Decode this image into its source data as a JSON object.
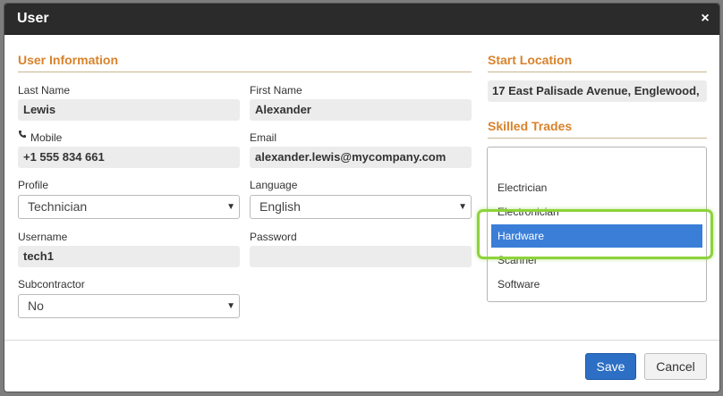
{
  "dialog": {
    "title": "User",
    "close_label": "×"
  },
  "user_info": {
    "section_title": "User Information",
    "last_name": {
      "label": "Last Name",
      "value": "Lewis"
    },
    "first_name": {
      "label": "First Name",
      "value": "Alexander"
    },
    "mobile": {
      "label": "Mobile",
      "value": "+1 555 834 661",
      "icon": "phone-icon"
    },
    "email": {
      "label": "Email",
      "value": "alexander.lewis@mycompany.com"
    },
    "profile": {
      "label": "Profile",
      "value": "Technician"
    },
    "language": {
      "label": "Language",
      "value": "English"
    },
    "username": {
      "label": "Username",
      "value": "tech1"
    },
    "password": {
      "label": "Password",
      "value": ""
    },
    "subcontractor": {
      "label": "Subcontractor",
      "value": "No"
    }
  },
  "start_location": {
    "section_title": "Start Location",
    "value": "17 East Palisade Avenue, Englewood,"
  },
  "skilled_trades": {
    "section_title": "Skilled Trades",
    "items": [
      {
        "label": "Electrician",
        "selected": false
      },
      {
        "label": "Electronician",
        "selected": false
      },
      {
        "label": "Hardware",
        "selected": true
      },
      {
        "label": "Scanner",
        "selected": false
      },
      {
        "label": "Software",
        "selected": false
      }
    ]
  },
  "footer": {
    "save_label": "Save",
    "cancel_label": "Cancel"
  },
  "colors": {
    "accent": "#d9822b",
    "selected_item": "#3b7ed8",
    "primary_button": "#2c6fc4",
    "highlight": "#8cd33a"
  }
}
